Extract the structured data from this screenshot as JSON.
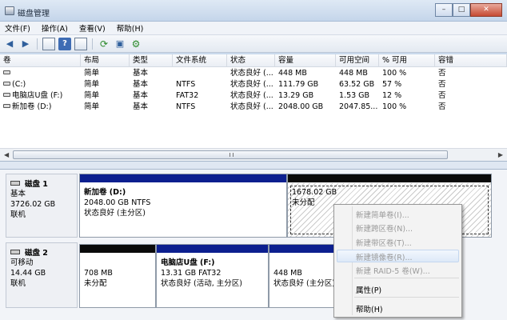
{
  "window": {
    "title": "磁盘管理",
    "buttons": [
      "–",
      "□",
      "✕"
    ]
  },
  "menu": [
    "文件(F)",
    "操作(A)",
    "查看(V)",
    "帮助(H)"
  ],
  "toolbar": [
    "back-icon",
    "forward-icon",
    "console-icon",
    "help-icon",
    "grid-icon",
    "refresh-icon",
    "properties-icon",
    "settings-icon"
  ],
  "table": {
    "headers": [
      "卷",
      "布局",
      "类型",
      "文件系统",
      "状态",
      "容量",
      "可用空间",
      "% 可用",
      "容错"
    ],
    "rows": [
      [
        "",
        "简单",
        "基本",
        "",
        "状态良好 (...",
        "448 MB",
        "448 MB",
        "100 %",
        "否"
      ],
      [
        "(C:)",
        "简单",
        "基本",
        "NTFS",
        "状态良好 (...",
        "111.79 GB",
        "63.52 GB",
        "57 %",
        "否"
      ],
      [
        "电脑店U盘 (F:)",
        "简单",
        "基本",
        "FAT32",
        "状态良好 (...",
        "13.29 GB",
        "1.53 GB",
        "12 %",
        "否"
      ],
      [
        "新加卷 (D:)",
        "简单",
        "基本",
        "NTFS",
        "状态良好 (...",
        "2048.00 GB",
        "2047.85...",
        "100 %",
        "否"
      ]
    ]
  },
  "disks": [
    {
      "name": "磁盘 1",
      "type": "基本",
      "size": "3726.02 GB",
      "status": "联机",
      "partitions": [
        {
          "title": "新加卷 (D:)",
          "line1": "2048.00 GB NTFS",
          "line2": "状态良好 (主分区)"
        },
        {
          "title": "",
          "line1": "1678.02 GB",
          "line2": "未分配"
        }
      ]
    },
    {
      "name": "磁盘 2",
      "type": "可移动",
      "size": "14.44 GB",
      "status": "联机",
      "partitions": [
        {
          "title": "",
          "line1": "708 MB",
          "line2": "未分配"
        },
        {
          "title": "电脑店U盘  (F:)",
          "line1": "13.31 GB FAT32",
          "line2": "状态良好 (活动, 主分区)"
        },
        {
          "title": "",
          "line1": "448 MB",
          "line2": "状态良好 (主分区)"
        }
      ]
    }
  ],
  "context_menu": {
    "items": [
      "新建简单卷(I)...",
      "新建跨区卷(N)...",
      "新建带区卷(T)...",
      "新建镜像卷(R)...",
      "新建 RAID-5 卷(W)...",
      "属性(P)",
      "帮助(H)"
    ],
    "disabled": [
      true,
      true,
      true,
      true,
      true,
      false,
      false
    ],
    "highlighted_index": 3
  },
  "colors": {
    "primary_bar": "#0c1f8f",
    "unallocated_bar": "#0a0a0a"
  }
}
